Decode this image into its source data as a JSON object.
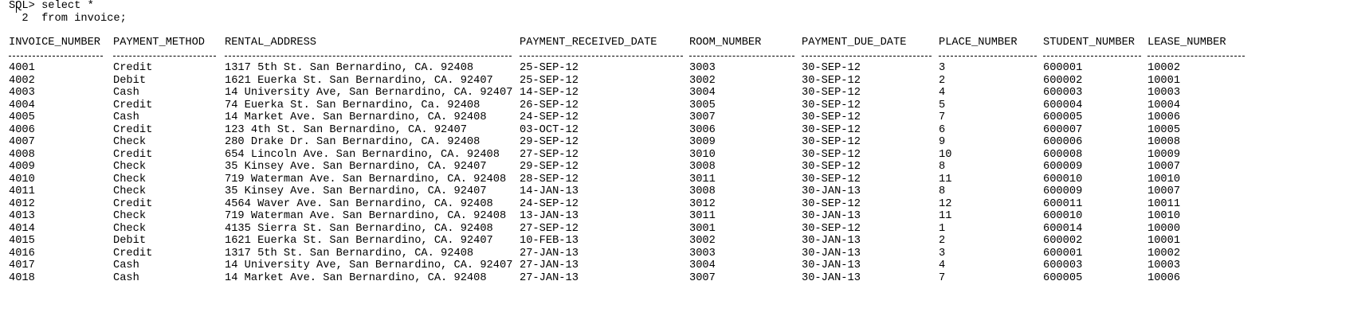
{
  "console": {
    "prompt_line": "SQL> select *",
    "continuation_line": "  2  from invoice;"
  },
  "columns": [
    "INVOICE_NUMBER",
    "PAYMENT_METHOD",
    "RENTAL_ADDRESS",
    "PAYMENT_RECEIVED_DATE",
    "ROOM_NUMBER",
    "PAYMENT_DUE_DATE",
    "PLACE_NUMBER",
    "STUDENT_NUMBER",
    "LEASE_NUMBER"
  ],
  "rows": [
    [
      "4001",
      "Credit",
      "1317 5th St. San Bernardino, CA. 92408",
      "25-SEP-12",
      "3003",
      "30-SEP-12",
      "3",
      "600001",
      "10002"
    ],
    [
      "4002",
      "Debit",
      "1621 Euerka St. San Bernardino, CA. 92407",
      "25-SEP-12",
      "3002",
      "30-SEP-12",
      "2",
      "600002",
      "10001"
    ],
    [
      "4003",
      "Cash",
      "14 University Ave, San Bernardino, CA. 92407",
      "14-SEP-12",
      "3004",
      "30-SEP-12",
      "4",
      "600003",
      "10003"
    ],
    [
      "4004",
      "Credit",
      "74 Euerka St. San Bernardino, Ca. 92408",
      "26-SEP-12",
      "3005",
      "30-SEP-12",
      "5",
      "600004",
      "10004"
    ],
    [
      "4005",
      "Cash",
      "14 Market Ave. San Bernardino, CA. 92408",
      "24-SEP-12",
      "3007",
      "30-SEP-12",
      "7",
      "600005",
      "10006"
    ],
    [
      "4006",
      "Credit",
      "123 4th St. San Bernardino, CA. 92407",
      "03-OCT-12",
      "3006",
      "30-SEP-12",
      "6",
      "600007",
      "10005"
    ],
    [
      "4007",
      "Check",
      "280 Drake Dr. San Bernardino, CA. 92408",
      "29-SEP-12",
      "3009",
      "30-SEP-12",
      "9",
      "600006",
      "10008"
    ],
    [
      "4008",
      "Credit",
      "654 Lincoln Ave. San Bernardino, CA. 92408",
      "27-SEP-12",
      "3010",
      "30-SEP-12",
      "10",
      "600008",
      "10009"
    ],
    [
      "4009",
      "Check",
      "35 Kinsey Ave. San Bernardino, CA. 92407",
      "29-SEP-12",
      "3008",
      "30-SEP-12",
      "8",
      "600009",
      "10007"
    ],
    [
      "4010",
      "Check",
      "719 Waterman Ave. San Bernardino, CA. 92408",
      "28-SEP-12",
      "3011",
      "30-SEP-12",
      "11",
      "600010",
      "10010"
    ],
    [
      "4011",
      "Check",
      "35 Kinsey Ave. San Bernardino, CA. 92407",
      "14-JAN-13",
      "3008",
      "30-JAN-13",
      "8",
      "600009",
      "10007"
    ],
    [
      "4012",
      "Credit",
      "4564 Waver Ave. San Bernardino, CA. 92408",
      "24-SEP-12",
      "3012",
      "30-SEP-12",
      "12",
      "600011",
      "10011"
    ],
    [
      "4013",
      "Check",
      "719 Waterman Ave. San Bernardino, CA. 92408",
      "13-JAN-13",
      "3011",
      "30-JAN-13",
      "11",
      "600010",
      "10010"
    ],
    [
      "4014",
      "Check",
      "4135 Sierra St. San Bernardino, CA. 92408",
      "27-SEP-12",
      "3001",
      "30-SEP-12",
      "1",
      "600014",
      "10000"
    ],
    [
      "4015",
      "Debit",
      "1621 Euerka St. San Bernardino, CA. 92407",
      "10-FEB-13",
      "3002",
      "30-JAN-13",
      "2",
      "600002",
      "10001"
    ],
    [
      "4016",
      "Credit",
      "1317 5th St. San Bernardino, CA. 92408",
      "27-JAN-13",
      "3003",
      "30-JAN-13",
      "3",
      "600001",
      "10002"
    ],
    [
      "4017",
      "Cash",
      "14 University Ave, San Bernardino, CA. 92407",
      "27-JAN-13",
      "3004",
      "30-JAN-13",
      "4",
      "600003",
      "10003"
    ],
    [
      "4018",
      "Cash",
      "14 Market Ave. San Bernardino, CA. 92408",
      "27-JAN-13",
      "3007",
      "30-JAN-13",
      "7",
      "600005",
      "10006"
    ]
  ]
}
